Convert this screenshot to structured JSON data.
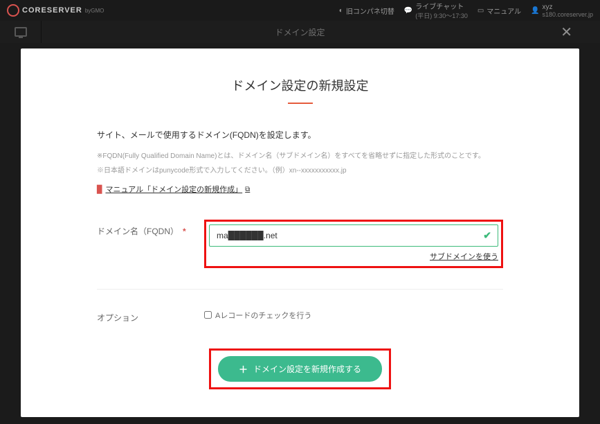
{
  "topbar": {
    "logo": "CORESERVER",
    "logo_sub": "byGMO",
    "old_panel": "旧コンパネ切替",
    "chat_label": "ライブチャット",
    "chat_hours": "(平日) 9:30〜17:30",
    "manual": "マニュアル",
    "user_name": "xyz",
    "user_server": "s180.coreserver.jp"
  },
  "subbar": {
    "title": "ドメイン設定",
    "close": "✕"
  },
  "modal": {
    "title": "ドメイン設定の新規設定",
    "intro": "サイト、メールで使用するドメイン(FQDN)を設定します。",
    "note1": "※FQDN(Fully Qualified Domain Name)とは、ドメイン名（サブドメイン名）をすべてを省略せずに指定した形式のことです。",
    "note2": "※日本語ドメインはpunycode形式で入力してください。（例）xn--xxxxxxxxxxx.jp",
    "manual_link": "マニュアル「ドメイン設定の新規作成」",
    "domain_label": "ドメイン名（FQDN）",
    "domain_value": "ma██████.net",
    "subdomain_link": "サブドメインを使う",
    "option_label": "オプション",
    "checkbox_label": "Aレコードのチェックを行う",
    "submit_label": "ドメイン設定を新規作成する"
  }
}
